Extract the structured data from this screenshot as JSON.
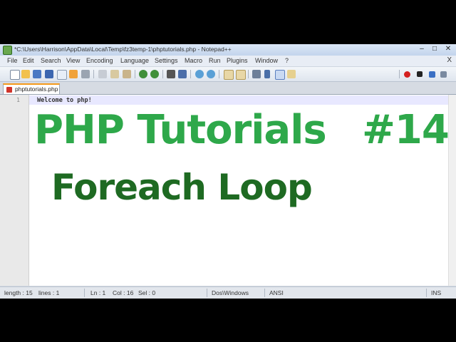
{
  "window": {
    "title": "*C:\\Users\\Harrison\\AppData\\Local\\Temp\\fz3temp-1\\phptutorials.php - Notepad++",
    "controls": {
      "minimize": "–",
      "maximize": "□",
      "close": "✕"
    }
  },
  "menu": {
    "items": [
      "File",
      "Edit",
      "Search",
      "View",
      "Encoding",
      "Language",
      "Settings",
      "Macro",
      "Run",
      "Plugins",
      "Window",
      "?"
    ],
    "close_label": "X"
  },
  "toolbar": {
    "icons": [
      "new-file-icon",
      "open-file-icon",
      "save-icon",
      "save-all-icon",
      "close-icon",
      "close-all-icon",
      "print-icon",
      "cut-icon",
      "copy-icon",
      "paste-icon",
      "undo-icon",
      "redo-icon",
      "find-icon",
      "replace-icon",
      "zoom-in-icon",
      "zoom-out-icon",
      "sync-v-icon",
      "sync-h-icon",
      "wrap-icon",
      "show-all-icon",
      "indent-guide-icon",
      "record-macro-icon",
      "stop-record-icon",
      "play-macro-icon"
    ]
  },
  "tabs": [
    {
      "label": "phptutorials.php"
    }
  ],
  "editor": {
    "lines": [
      {
        "number": "1",
        "text": "Welcome to php!"
      }
    ]
  },
  "overlay": {
    "title": "PHP Tutorials",
    "number": "#14",
    "subtitle": "Foreach Loop",
    "colors": {
      "title": "#2ea84a",
      "subtitle": "#1e6a22"
    }
  },
  "status": {
    "length": "length : 15",
    "lines": "lines : 1",
    "ln": "Ln : 1",
    "col": "Col : 16",
    "sel": "Sel : 0",
    "eol": "Dos\\Windows",
    "encoding": "ANSI",
    "mode": "INS"
  }
}
